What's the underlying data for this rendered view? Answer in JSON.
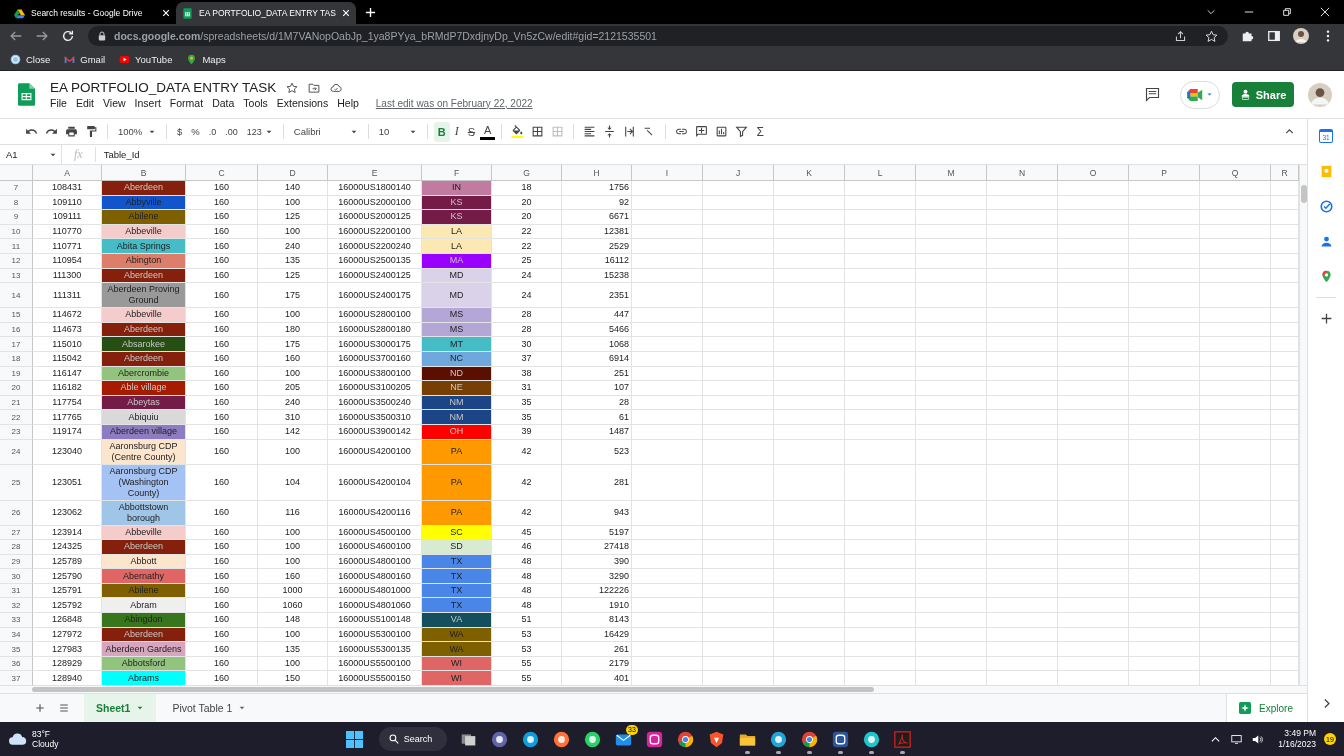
{
  "browser": {
    "tabs": [
      {
        "kind": "drive",
        "title": "Search results - Google Drive",
        "selected": false
      },
      {
        "kind": "sheets",
        "title": "EA PORTFOLIO_DATA ENTRY TAS",
        "selected": true
      }
    ],
    "address": "**docs.google.com**/spreadsheets/d/1M7VANopOabJp_1ya8PYya_bRMdP7DxdjnyDp_Vn5zCw/edit#gid=2121535501",
    "bookmarks": [
      {
        "kind": "wordpress",
        "label": "Close"
      },
      {
        "kind": "gmail",
        "label": "Gmail"
      },
      {
        "kind": "youtube",
        "label": "YouTube"
      },
      {
        "kind": "maps",
        "label": "Maps"
      }
    ]
  },
  "document": {
    "title": "EA PORTFOLIO_DATA ENTRY TASK",
    "menus": [
      "File",
      "Edit",
      "View",
      "Insert",
      "Format",
      "Data",
      "Tools",
      "Extensions",
      "Help"
    ],
    "last_edit": "Last edit was on February 22, 2022",
    "share": "Share"
  },
  "toolbar": {
    "zoom": "100%",
    "currency": "$",
    "percent": "%",
    "decrease_decimals": ".0",
    "increase_decimals": ".00",
    "more_formats": "123",
    "font": "Calibri",
    "font_size": "10",
    "bold": {
      "label": "B",
      "selected": true
    },
    "italic": "I",
    "strikethrough": "S",
    "text_color": "A",
    "functions": "Σ"
  },
  "formula_bar": {
    "cell_ref": "A1",
    "fx": "fx",
    "value": "Table_Id"
  },
  "columns": [
    "A",
    "B",
    "C",
    "D",
    "E",
    "F",
    "G",
    "H",
    "I",
    "J",
    "K",
    "L",
    "M",
    "N",
    "O",
    "P",
    "Q",
    "R"
  ],
  "rows": [
    {
      "number": "7",
      "cells": [
        {
          "text": "108431"
        },
        {
          "text": "Aberdeen",
          "color": "#85200c"
        },
        {
          "text": "160"
        },
        {
          "text": "140"
        },
        {
          "text": "16000US1800140"
        },
        {
          "text": "IN",
          "color": "#c27ba0"
        },
        {
          "text": "18"
        },
        {
          "text": "1756"
        }
      ]
    },
    {
      "number": "8",
      "cells": [
        {
          "text": "109110"
        },
        {
          "text": "Abbyville",
          "color": "#1155cc"
        },
        {
          "text": "160"
        },
        {
          "text": "100"
        },
        {
          "text": "16000US2000100"
        },
        {
          "text": "KS",
          "color": "#741b47"
        },
        {
          "text": "20"
        },
        {
          "text": "92"
        }
      ]
    },
    {
      "number": "9",
      "cells": [
        {
          "text": "109111"
        },
        {
          "text": "Abilene",
          "color": "#7f6000"
        },
        {
          "text": "160"
        },
        {
          "text": "125"
        },
        {
          "text": "16000US2000125"
        },
        {
          "text": "KS",
          "color": "#741b47"
        },
        {
          "text": "20"
        },
        {
          "text": "6671"
        }
      ]
    },
    {
      "number": "10",
      "cells": [
        {
          "text": "110770"
        },
        {
          "text": "Abbeville",
          "color": "#f4cccc"
        },
        {
          "text": "160"
        },
        {
          "text": "100"
        },
        {
          "text": "16000US2200100"
        },
        {
          "text": "LA",
          "color": "#fce8b2"
        },
        {
          "text": "22"
        },
        {
          "text": "12381"
        }
      ]
    },
    {
      "number": "11",
      "cells": [
        {
          "text": "110771"
        },
        {
          "text": "Abita Springs",
          "color": "#46bdc6"
        },
        {
          "text": "160"
        },
        {
          "text": "240"
        },
        {
          "text": "16000US2200240"
        },
        {
          "text": "LA",
          "color": "#fce8b2"
        },
        {
          "text": "22"
        },
        {
          "text": "2529"
        }
      ]
    },
    {
      "number": "12",
      "cells": [
        {
          "text": "110954"
        },
        {
          "text": "Abington",
          "color": "#dd7e6b"
        },
        {
          "text": "160"
        },
        {
          "text": "135"
        },
        {
          "text": "16000US2500135"
        },
        {
          "text": "MA",
          "color": "#9900ff"
        },
        {
          "text": "25"
        },
        {
          "text": "16112"
        }
      ]
    },
    {
      "number": "13",
      "cells": [
        {
          "text": "111300"
        },
        {
          "text": "Aberdeen",
          "color": "#85200c"
        },
        {
          "text": "160"
        },
        {
          "text": "125"
        },
        {
          "text": "16000US2400125"
        },
        {
          "text": "MD",
          "color": "#d9d2e9"
        },
        {
          "text": "24"
        },
        {
          "text": "15238"
        }
      ]
    },
    {
      "number": "14",
      "cells": [
        {
          "text": "111311"
        },
        {
          "text": "Aberdeen Proving Ground",
          "color": "#999999"
        },
        {
          "text": "160"
        },
        {
          "text": "175"
        },
        {
          "text": "16000US2400175"
        },
        {
          "text": "MD",
          "color": "#d9d2e9"
        },
        {
          "text": "24"
        },
        {
          "text": "2351"
        }
      ]
    },
    {
      "number": "15",
      "cells": [
        {
          "text": "114672"
        },
        {
          "text": "Abbeville",
          "color": "#f4cccc"
        },
        {
          "text": "160"
        },
        {
          "text": "100"
        },
        {
          "text": "16000US2800100"
        },
        {
          "text": "MS",
          "color": "#b4a7d6"
        },
        {
          "text": "28"
        },
        {
          "text": "447"
        }
      ]
    },
    {
      "number": "16",
      "cells": [
        {
          "text": "114673"
        },
        {
          "text": "Aberdeen",
          "color": "#85200c"
        },
        {
          "text": "160"
        },
        {
          "text": "180"
        },
        {
          "text": "16000US2800180"
        },
        {
          "text": "MS",
          "color": "#b4a7d6"
        },
        {
          "text": "28"
        },
        {
          "text": "5466"
        }
      ]
    },
    {
      "number": "17",
      "cells": [
        {
          "text": "115010"
        },
        {
          "text": "Absarokee",
          "color": "#274e13"
        },
        {
          "text": "160"
        },
        {
          "text": "175"
        },
        {
          "text": "16000US3000175"
        },
        {
          "text": "MT",
          "color": "#46bdc6"
        },
        {
          "text": "30"
        },
        {
          "text": "1068"
        }
      ]
    },
    {
      "number": "18",
      "cells": [
        {
          "text": "115042"
        },
        {
          "text": "Aberdeen",
          "color": "#85200c"
        },
        {
          "text": "160"
        },
        {
          "text": "160"
        },
        {
          "text": "16000US3700160"
        },
        {
          "text": "NC",
          "color": "#6fa8dc"
        },
        {
          "text": "37"
        },
        {
          "text": "6914"
        }
      ]
    },
    {
      "number": "19",
      "cells": [
        {
          "text": "116147"
        },
        {
          "text": "Abercrombie",
          "color": "#93c47d"
        },
        {
          "text": "160"
        },
        {
          "text": "100"
        },
        {
          "text": "16000US3800100"
        },
        {
          "text": "ND",
          "color": "#5b0f00"
        },
        {
          "text": "38"
        },
        {
          "text": "251"
        }
      ]
    },
    {
      "number": "20",
      "cells": [
        {
          "text": "116182"
        },
        {
          "text": "Able village",
          "color": "#a61c00"
        },
        {
          "text": "160"
        },
        {
          "text": "205"
        },
        {
          "text": "16000US3100205"
        },
        {
          "text": "NE",
          "color": "#783f04"
        },
        {
          "text": "31"
        },
        {
          "text": "107"
        }
      ]
    },
    {
      "number": "21",
      "cells": [
        {
          "text": "117754"
        },
        {
          "text": "Abeytas",
          "color": "#741b47"
        },
        {
          "text": "160"
        },
        {
          "text": "240"
        },
        {
          "text": "16000US3500240"
        },
        {
          "text": "NM",
          "color": "#1c4587"
        },
        {
          "text": "35"
        },
        {
          "text": "28"
        }
      ]
    },
    {
      "number": "22",
      "cells": [
        {
          "text": "117765"
        },
        {
          "text": "Abiquiu",
          "color": "#d9d9d9"
        },
        {
          "text": "160"
        },
        {
          "text": "310"
        },
        {
          "text": "16000US3500310"
        },
        {
          "text": "NM",
          "color": "#1c4587"
        },
        {
          "text": "35"
        },
        {
          "text": "61"
        }
      ]
    },
    {
      "number": "23",
      "cells": [
        {
          "text": "119174"
        },
        {
          "text": "Aberdeen village",
          "color": "#8e7cc3"
        },
        {
          "text": "160"
        },
        {
          "text": "142"
        },
        {
          "text": "16000US3900142"
        },
        {
          "text": "OH",
          "color": "#ff0000"
        },
        {
          "text": "39"
        },
        {
          "text": "1487"
        }
      ]
    },
    {
      "number": "24",
      "cells": [
        {
          "text": "123040"
        },
        {
          "text": "Aaronsburg CDP (Centre County)",
          "color": "#fce5cd"
        },
        {
          "text": "160"
        },
        {
          "text": "100"
        },
        {
          "text": "16000US4200100"
        },
        {
          "text": "PA",
          "color": "#ff9900"
        },
        {
          "text": "42"
        },
        {
          "text": "523"
        }
      ]
    },
    {
      "number": "25",
      "cells": [
        {
          "text": "123051"
        },
        {
          "text": "Aaronsburg CDP (Washington County)",
          "color": "#a4c2f4"
        },
        {
          "text": "160"
        },
        {
          "text": "104"
        },
        {
          "text": "16000US4200104"
        },
        {
          "text": "PA",
          "color": "#ff9900"
        },
        {
          "text": "42"
        },
        {
          "text": "281"
        }
      ]
    },
    {
      "number": "26",
      "cells": [
        {
          "text": "123062"
        },
        {
          "text": "Abbottstown borough",
          "color": "#9fc5e8"
        },
        {
          "text": "160"
        },
        {
          "text": "116"
        },
        {
          "text": "16000US4200116"
        },
        {
          "text": "PA",
          "color": "#ff9900"
        },
        {
          "text": "42"
        },
        {
          "text": "943"
        }
      ]
    },
    {
      "number": "27",
      "cells": [
        {
          "text": "123914"
        },
        {
          "text": "Abbeville",
          "color": "#f4cccc"
        },
        {
          "text": "160"
        },
        {
          "text": "100"
        },
        {
          "text": "16000US4500100"
        },
        {
          "text": "SC",
          "color": "#ffff00"
        },
        {
          "text": "45"
        },
        {
          "text": "5197"
        }
      ]
    },
    {
      "number": "28",
      "cells": [
        {
          "text": "124325"
        },
        {
          "text": "Aberdeen",
          "color": "#85200c"
        },
        {
          "text": "160"
        },
        {
          "text": "100"
        },
        {
          "text": "16000US4600100"
        },
        {
          "text": "SD",
          "color": "#d9ead3"
        },
        {
          "text": "46"
        },
        {
          "text": "27418"
        }
      ]
    },
    {
      "number": "29",
      "cells": [
        {
          "text": "125789"
        },
        {
          "text": "Abbott",
          "color": "#fce5cd"
        },
        {
          "text": "160"
        },
        {
          "text": "100"
        },
        {
          "text": "16000US4800100"
        },
        {
          "text": "TX",
          "color": "#4a86e8"
        },
        {
          "text": "48"
        },
        {
          "text": "390"
        }
      ]
    },
    {
      "number": "30",
      "cells": [
        {
          "text": "125790"
        },
        {
          "text": "Abernathy",
          "color": "#e06666"
        },
        {
          "text": "160"
        },
        {
          "text": "160"
        },
        {
          "text": "16000US4800160"
        },
        {
          "text": "TX",
          "color": "#4a86e8"
        },
        {
          "text": "48"
        },
        {
          "text": "3290"
        }
      ]
    },
    {
      "number": "31",
      "cells": [
        {
          "text": "125791"
        },
        {
          "text": "Abilene",
          "color": "#7f6000"
        },
        {
          "text": "160"
        },
        {
          "text": "1000"
        },
        {
          "text": "16000US4801000"
        },
        {
          "text": "TX",
          "color": "#4a86e8"
        },
        {
          "text": "48"
        },
        {
          "text": "122226"
        }
      ]
    },
    {
      "number": "32",
      "cells": [
        {
          "text": "125792"
        },
        {
          "text": "Abram",
          "color": "#efefef"
        },
        {
          "text": "160"
        },
        {
          "text": "1060"
        },
        {
          "text": "16000US4801060"
        },
        {
          "text": "TX",
          "color": "#4a86e8"
        },
        {
          "text": "48"
        },
        {
          "text": "1910"
        }
      ]
    },
    {
      "number": "33",
      "cells": [
        {
          "text": "126848"
        },
        {
          "text": "Abingdon",
          "color": "#38761d"
        },
        {
          "text": "160"
        },
        {
          "text": "148"
        },
        {
          "text": "16000US5100148"
        },
        {
          "text": "VA",
          "color": "#134f5c"
        },
        {
          "text": "51"
        },
        {
          "text": "8143"
        }
      ]
    },
    {
      "number": "34",
      "cells": [
        {
          "text": "127972"
        },
        {
          "text": "Aberdeen",
          "color": "#85200c"
        },
        {
          "text": "160"
        },
        {
          "text": "100"
        },
        {
          "text": "16000US5300100"
        },
        {
          "text": "WA",
          "color": "#7f6000"
        },
        {
          "text": "53"
        },
        {
          "text": "16429"
        }
      ]
    },
    {
      "number": "35",
      "cells": [
        {
          "text": "127983"
        },
        {
          "text": "Aberdeen Gardens",
          "color": "#d5a6bd"
        },
        {
          "text": "160"
        },
        {
          "text": "135"
        },
        {
          "text": "16000US5300135"
        },
        {
          "text": "WA",
          "color": "#7f6000"
        },
        {
          "text": "53"
        },
        {
          "text": "261"
        }
      ]
    },
    {
      "number": "36",
      "cells": [
        {
          "text": "128929"
        },
        {
          "text": "Abbotsford",
          "color": "#93c47d"
        },
        {
          "text": "160"
        },
        {
          "text": "100"
        },
        {
          "text": "16000US5500100"
        },
        {
          "text": "WI",
          "color": "#e06666"
        },
        {
          "text": "55"
        },
        {
          "text": "2179"
        }
      ]
    },
    {
      "number": "37",
      "cells": [
        {
          "text": "128940"
        },
        {
          "text": "Abrams",
          "color": "#00ffff"
        },
        {
          "text": "160"
        },
        {
          "text": "150"
        },
        {
          "text": "16000US5500150"
        },
        {
          "text": "WI",
          "color": "#e06666"
        },
        {
          "text": "55"
        },
        {
          "text": "401"
        }
      ]
    }
  ],
  "side_panel": {
    "calendar_day": "31"
  },
  "sheet_tabs": [
    {
      "name": "Sheet1",
      "selected": true
    },
    {
      "name": "Pivot Table 1",
      "selected": false
    }
  ],
  "explore": "Explore",
  "taskbar": {
    "temperature": "83°F",
    "condition": "Cloudy",
    "search": "Search",
    "apps": [
      {
        "running": false
      },
      {
        "running": false
      },
      {
        "running": false
      },
      {
        "running": false
      },
      {
        "running": false
      },
      {
        "running": false,
        "badge": "33"
      },
      {
        "running": false
      },
      {
        "running": false
      },
      {
        "running": false
      },
      {
        "running": true
      },
      {
        "running": true
      },
      {
        "running": true
      },
      {
        "running": true
      },
      {
        "running": true
      },
      {
        "running": true
      }
    ],
    "time": "3:49 PM",
    "date": "1/16/2023",
    "notifications": "19"
  }
}
